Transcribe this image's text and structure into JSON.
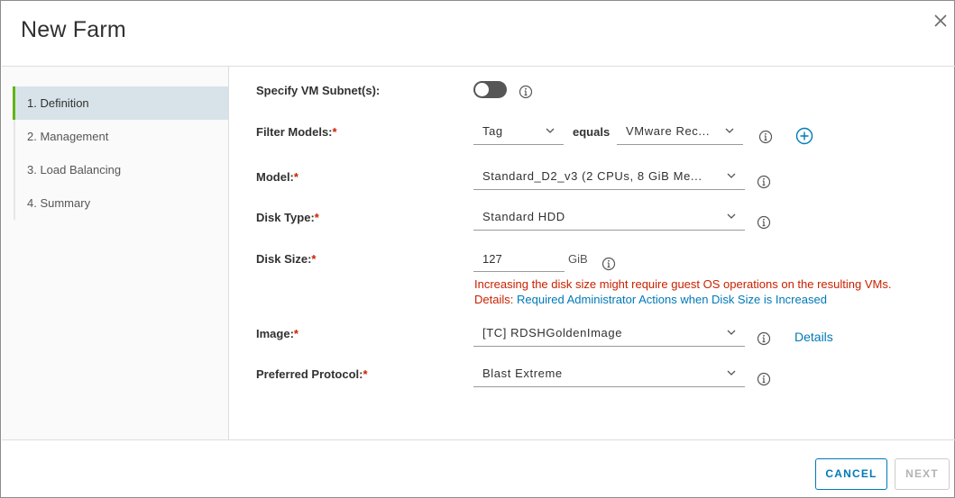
{
  "dialog": {
    "title": "New Farm"
  },
  "steps": [
    {
      "label": "1. Definition",
      "active": true
    },
    {
      "label": "2. Management",
      "active": false
    },
    {
      "label": "3. Load Balancing",
      "active": false
    },
    {
      "label": "4. Summary",
      "active": false
    }
  ],
  "form": {
    "subnet": {
      "label": "Specify VM Subnet(s):",
      "enabled": false
    },
    "filter_models": {
      "label": "Filter Models:",
      "field": "Tag",
      "operator": "equals",
      "value": "VMware Rec..."
    },
    "model": {
      "label": "Model:",
      "value": "Standard_D2_v3 (2 CPUs, 8 GiB Me..."
    },
    "disk_type": {
      "label": "Disk Type:",
      "value": "Standard HDD"
    },
    "disk_size": {
      "label": "Disk Size:",
      "value": "127",
      "unit": "GiB",
      "warning": "Increasing the disk size might require guest OS operations on the resulting VMs.",
      "details_prefix": "Details:",
      "details_link": "Required Administrator Actions when Disk Size is Increased"
    },
    "image": {
      "label": "Image:",
      "value": "[TC] RDSHGoldenImage",
      "details_link": "Details"
    },
    "protocol": {
      "label": "Preferred Protocol:",
      "value": "Blast Extreme"
    },
    "required_marker": "*"
  },
  "footer": {
    "cancel_label": "CANCEL",
    "next_label": "NEXT"
  },
  "colors": {
    "accent": "#0079b8",
    "active_step_bar": "#60b515",
    "active_step_bg": "#d8e3e9",
    "error": "#c92100"
  }
}
